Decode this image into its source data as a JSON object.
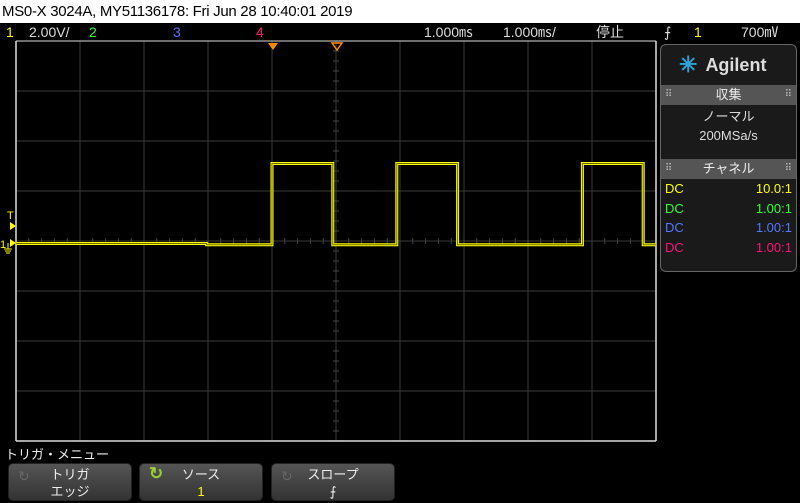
{
  "title": "MS0-X 3024A, MY51136178: Fri Jun 28 10:40:01 2019",
  "status": {
    "ch1_num": "1",
    "ch1_scale": "2.00V/",
    "ch2_num": "2",
    "ch3_num": "3",
    "ch4_num": "4",
    "delay": "1.000㎳",
    "timebase": "1.000㎳/",
    "run_state": "停止",
    "trig_slope_icon": "rising-edge",
    "trig_source": "1",
    "trig_level": "700㎷"
  },
  "colors": {
    "ch1": "#ffff00",
    "ch2": "#33ff33",
    "ch3": "#5577ff",
    "ch4": "#ff1177",
    "orange": "#ff8c00"
  },
  "side": {
    "brand": "Agilent",
    "acq_header": "収集",
    "acq_mode": "ノーマル",
    "acq_rate": "200MSa/s",
    "chan_header": "チャネル",
    "channels": [
      {
        "coupling": "DC",
        "probe": "10.0:1"
      },
      {
        "coupling": "DC",
        "probe": "1.00:1"
      },
      {
        "coupling": "DC",
        "probe": "1.00:1"
      },
      {
        "coupling": "DC",
        "probe": "1.00:1"
      }
    ]
  },
  "markers": {
    "trigger": "T",
    "ch1": "1"
  },
  "menu": {
    "title": "トリガ・メニュー",
    "softkeys": [
      {
        "label": "トリガ",
        "value": "エッジ"
      },
      {
        "label": "ソース",
        "value": "1"
      },
      {
        "label": "スロープ",
        "value": "⨍"
      }
    ]
  },
  "waveform": {
    "unit_note": "ch1 volts vs ms",
    "low_v": 0.0,
    "high_v": 3.2,
    "segments_div": [
      [
        0,
        0
      ],
      [
        2.98,
        -0.05
      ],
      [
        4.0,
        3.2
      ],
      [
        4.95,
        -0.05
      ],
      [
        5.95,
        3.2
      ],
      [
        6.9,
        -0.05
      ],
      [
        8.85,
        3.2
      ],
      [
        9.8,
        -0.05
      ],
      [
        10,
        -0.05
      ]
    ]
  }
}
